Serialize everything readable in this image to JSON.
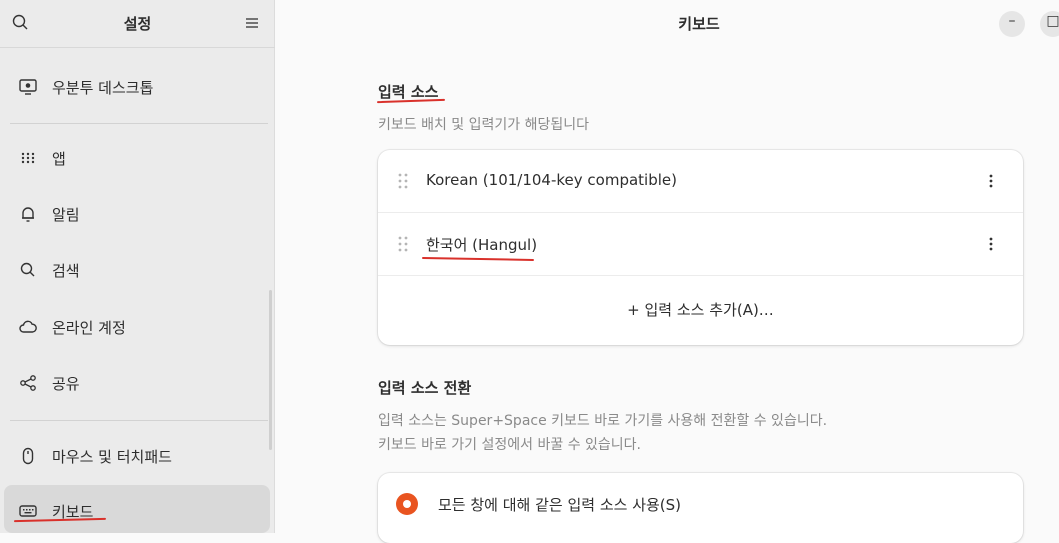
{
  "sidebar": {
    "title": "설정",
    "items": [
      {
        "label": "우분투 데스크톱",
        "icon": "desktop-icon"
      },
      {
        "label": "앱",
        "icon": "apps-grid-icon"
      },
      {
        "label": "알림",
        "icon": "bell-icon"
      },
      {
        "label": "검색",
        "icon": "search-icon"
      },
      {
        "label": "온라인 계정",
        "icon": "cloud-icon"
      },
      {
        "label": "공유",
        "icon": "share-icon"
      },
      {
        "label": "마우스 및 터치패드",
        "icon": "mouse-icon"
      },
      {
        "label": "키보드",
        "icon": "keyboard-icon",
        "active": true
      }
    ]
  },
  "header": {
    "title": "키보드",
    "minimize": "–",
    "maximize": "□"
  },
  "input_sources": {
    "title": "입력 소스",
    "subtitle": "키보드 배치 및 입력기가 해당됩니다",
    "items": [
      {
        "label": "Korean (101/104-key compatible)"
      },
      {
        "label": "한국어 (Hangul)"
      }
    ],
    "add_label": "+  입력 소스 추가(A)…"
  },
  "switching": {
    "title": "입력 소스 전환",
    "description_line1": "입력 소스는 Super+Space 키보드 바로 가기를 사용해 전환할 수 있습니다.",
    "description_line2": "키보드 바로 가기 설정에서 바꿀 수 있습니다.",
    "option_label": "모든 창에 대해 같은 입력 소스 사용(S)",
    "option_selected": true
  },
  "colors": {
    "accent": "#e95420",
    "annotation": "#d9312b"
  }
}
